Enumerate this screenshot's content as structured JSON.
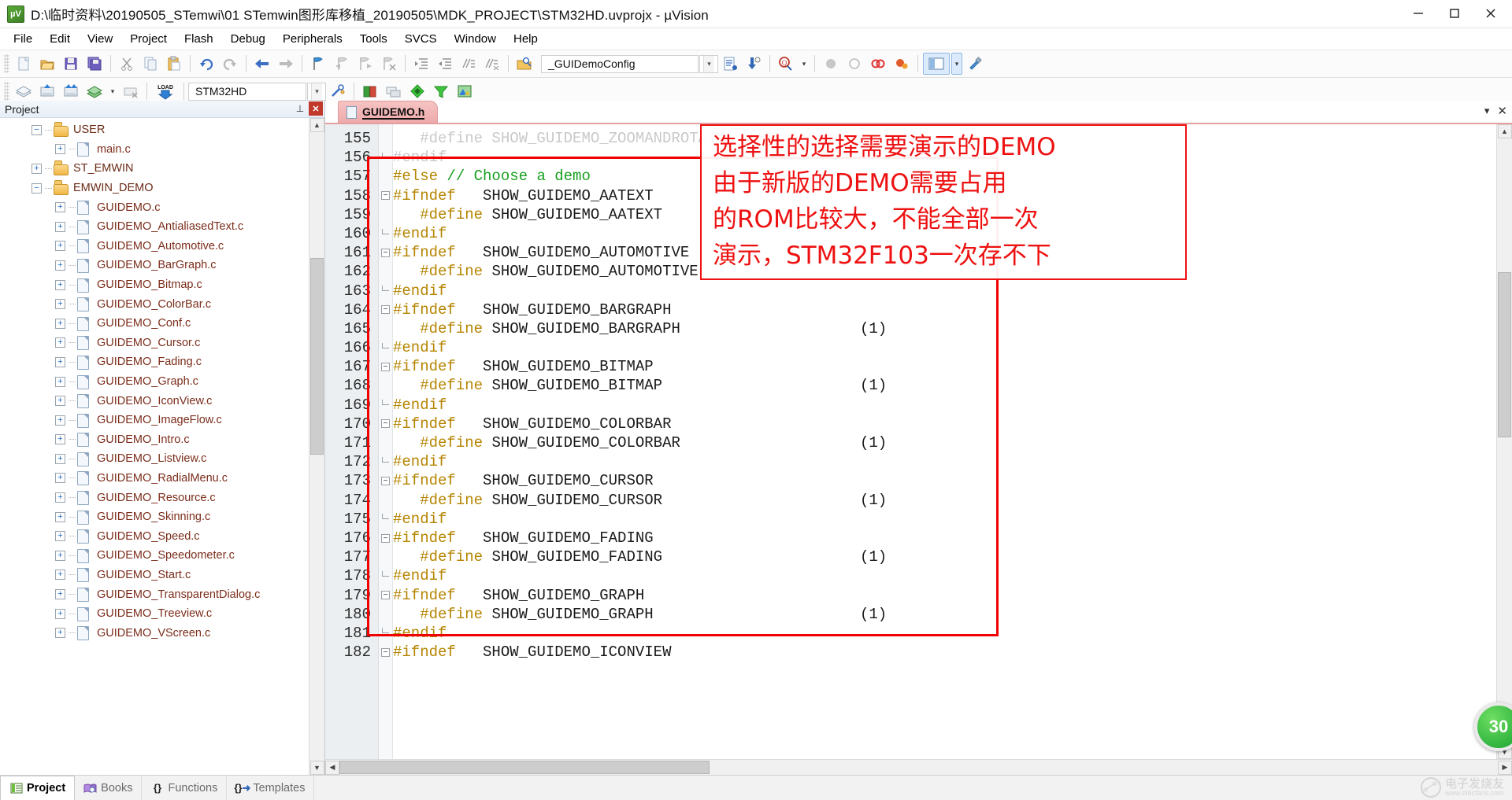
{
  "titlebar": {
    "title": "D:\\临时资料\\20190505_STemwi\\01 STemwin图形库移植_20190505\\MDK_PROJECT\\STM32HD.uvprojx - µVision",
    "app_icon": "uvision-icon",
    "minimize": "—",
    "maximize": "▢",
    "close": "✕"
  },
  "menubar": {
    "items": [
      "File",
      "Edit",
      "View",
      "Project",
      "Flash",
      "Debug",
      "Peripherals",
      "Tools",
      "SVCS",
      "Window",
      "Help"
    ]
  },
  "toolbar1": {
    "target_combo_value": "_GUIDemoConfig",
    "buttons": [
      "new-file-icon",
      "open-file-icon",
      "save-icon",
      "save-all-icon",
      "cut-icon",
      "copy-icon",
      "paste-icon",
      "undo-icon",
      "redo-icon",
      "navigate-back-icon",
      "navigate-forward-icon",
      "bookmark-toggle-icon",
      "bookmark-prev-icon",
      "bookmark-next-icon",
      "bookmark-clear-icon",
      "indent-icon",
      "outdent-icon",
      "comment-icon",
      "uncomment-icon",
      "browse-icon",
      "config-wizard-icon",
      "insert-include-icon",
      "find-in-files-icon",
      "debug-start-icon",
      "debug-stop-icon",
      "breakpoint-icon",
      "breakpoint-disable-icon",
      "window-layout-icon",
      "configure-icon"
    ]
  },
  "toolbar2": {
    "target_combo_value": "STM32HD",
    "buttons": [
      "translate-icon",
      "build-icon",
      "rebuild-icon",
      "batch-build-icon",
      "stop-build-icon",
      "download-icon",
      "target-options-icon",
      "manage-targets-icon",
      "multi-project-icon",
      "new-component-icon",
      "pack-installer-icon",
      "manage-run-env-icon"
    ]
  },
  "project_panel": {
    "header": "Project",
    "pin_icon": "pin-icon",
    "close_icon": "close-icon",
    "tree": [
      {
        "label": "USER",
        "indent": 1,
        "expander": "−",
        "icon": "folder-open-icon"
      },
      {
        "label": "main.c",
        "indent": 2,
        "expander": "+",
        "icon": "c-file-icon"
      },
      {
        "label": "ST_EMWIN",
        "indent": 1,
        "expander": "+",
        "icon": "folder-icon"
      },
      {
        "label": "EMWIN_DEMO",
        "indent": 1,
        "expander": "−",
        "icon": "folder-open-icon"
      },
      {
        "label": "GUIDEMO.c",
        "indent": 2,
        "expander": "+",
        "icon": "c-file-icon"
      },
      {
        "label": "GUIDEMO_AntialiasedText.c",
        "indent": 2,
        "expander": "+",
        "icon": "c-file-icon"
      },
      {
        "label": "GUIDEMO_Automotive.c",
        "indent": 2,
        "expander": "+",
        "icon": "c-file-icon"
      },
      {
        "label": "GUIDEMO_BarGraph.c",
        "indent": 2,
        "expander": "+",
        "icon": "c-file-icon"
      },
      {
        "label": "GUIDEMO_Bitmap.c",
        "indent": 2,
        "expander": "+",
        "icon": "c-file-icon"
      },
      {
        "label": "GUIDEMO_ColorBar.c",
        "indent": 2,
        "expander": "+",
        "icon": "c-file-icon"
      },
      {
        "label": "GUIDEMO_Conf.c",
        "indent": 2,
        "expander": "+",
        "icon": "c-file-icon"
      },
      {
        "label": "GUIDEMO_Cursor.c",
        "indent": 2,
        "expander": "+",
        "icon": "c-file-icon"
      },
      {
        "label": "GUIDEMO_Fading.c",
        "indent": 2,
        "expander": "+",
        "icon": "c-file-icon"
      },
      {
        "label": "GUIDEMO_Graph.c",
        "indent": 2,
        "expander": "+",
        "icon": "c-file-icon"
      },
      {
        "label": "GUIDEMO_IconView.c",
        "indent": 2,
        "expander": "+",
        "icon": "c-file-icon"
      },
      {
        "label": "GUIDEMO_ImageFlow.c",
        "indent": 2,
        "expander": "+",
        "icon": "c-file-icon"
      },
      {
        "label": "GUIDEMO_Intro.c",
        "indent": 2,
        "expander": "+",
        "icon": "c-file-icon"
      },
      {
        "label": "GUIDEMO_Listview.c",
        "indent": 2,
        "expander": "+",
        "icon": "c-file-icon"
      },
      {
        "label": "GUIDEMO_RadialMenu.c",
        "indent": 2,
        "expander": "+",
        "icon": "c-file-icon"
      },
      {
        "label": "GUIDEMO_Resource.c",
        "indent": 2,
        "expander": "+",
        "icon": "c-file-icon"
      },
      {
        "label": "GUIDEMO_Skinning.c",
        "indent": 2,
        "expander": "+",
        "icon": "c-file-icon"
      },
      {
        "label": "GUIDEMO_Speed.c",
        "indent": 2,
        "expander": "+",
        "icon": "c-file-icon"
      },
      {
        "label": "GUIDEMO_Speedometer.c",
        "indent": 2,
        "expander": "+",
        "icon": "c-file-icon"
      },
      {
        "label": "GUIDEMO_Start.c",
        "indent": 2,
        "expander": "+",
        "icon": "c-file-icon"
      },
      {
        "label": "GUIDEMO_TransparentDialog.c",
        "indent": 2,
        "expander": "+",
        "icon": "c-file-icon"
      },
      {
        "label": "GUIDEMO_Treeview.c",
        "indent": 2,
        "expander": "+",
        "icon": "c-file-icon"
      },
      {
        "label": "GUIDEMO_VScreen.c",
        "indent": 2,
        "expander": "+",
        "icon": "c-file-icon"
      }
    ]
  },
  "editor": {
    "tab_label": "GUIDEMO.h",
    "tab_icon": "h-file-icon",
    "lines": [
      {
        "n": "155",
        "fold": "",
        "text": "   #define SHOW_GUIDEMO_ZOOMANDROTATE",
        "style": "dim"
      },
      {
        "n": "156",
        "fold": "-",
        "text": "#endif",
        "style": "dim"
      },
      {
        "n": "157",
        "fold": "",
        "text": "#else // Choose a demo",
        "style": "else"
      },
      {
        "n": "158",
        "fold": "⊟",
        "text": "#ifndef   SHOW_GUIDEMO_AATEXT",
        "style": "ifndef"
      },
      {
        "n": "159",
        "fold": "",
        "text": "   #define SHOW_GUIDEMO_AATEXT",
        "style": "define",
        "value": ""
      },
      {
        "n": "160",
        "fold": "-",
        "text": "#endif",
        "style": "endif"
      },
      {
        "n": "161",
        "fold": "⊟",
        "text": "#ifndef   SHOW_GUIDEMO_AUTOMOTIVE",
        "style": "ifndef"
      },
      {
        "n": "162",
        "fold": "",
        "text": "   #define SHOW_GUIDEMO_AUTOMOTIVE",
        "style": "define",
        "value": ""
      },
      {
        "n": "163",
        "fold": "-",
        "text": "#endif",
        "style": "endif"
      },
      {
        "n": "164",
        "fold": "⊟",
        "text": "#ifndef   SHOW_GUIDEMO_BARGRAPH",
        "style": "ifndef"
      },
      {
        "n": "165",
        "fold": "",
        "text": "   #define SHOW_GUIDEMO_BARGRAPH",
        "style": "define",
        "value": "(1)"
      },
      {
        "n": "166",
        "fold": "-",
        "text": "#endif",
        "style": "endif"
      },
      {
        "n": "167",
        "fold": "⊟",
        "text": "#ifndef   SHOW_GUIDEMO_BITMAP",
        "style": "ifndef"
      },
      {
        "n": "168",
        "fold": "",
        "text": "   #define SHOW_GUIDEMO_BITMAP",
        "style": "define",
        "value": "(1)"
      },
      {
        "n": "169",
        "fold": "-",
        "text": "#endif",
        "style": "endif"
      },
      {
        "n": "170",
        "fold": "⊟",
        "text": "#ifndef   SHOW_GUIDEMO_COLORBAR",
        "style": "ifndef"
      },
      {
        "n": "171",
        "fold": "",
        "text": "   #define SHOW_GUIDEMO_COLORBAR",
        "style": "define",
        "value": "(1)"
      },
      {
        "n": "172",
        "fold": "-",
        "text": "#endif",
        "style": "endif"
      },
      {
        "n": "173",
        "fold": "⊟",
        "text": "#ifndef   SHOW_GUIDEMO_CURSOR",
        "style": "ifndef"
      },
      {
        "n": "174",
        "fold": "",
        "text": "   #define SHOW_GUIDEMO_CURSOR",
        "style": "define",
        "value": "(1)"
      },
      {
        "n": "175",
        "fold": "-",
        "text": "#endif",
        "style": "endif"
      },
      {
        "n": "176",
        "fold": "⊟",
        "text": "#ifndef   SHOW_GUIDEMO_FADING",
        "style": "ifndef"
      },
      {
        "n": "177",
        "fold": "",
        "text": "   #define SHOW_GUIDEMO_FADING",
        "style": "define",
        "value": "(1)"
      },
      {
        "n": "178",
        "fold": "-",
        "text": "#endif",
        "style": "endif"
      },
      {
        "n": "179",
        "fold": "⊟",
        "text": "#ifndef   SHOW_GUIDEMO_GRAPH",
        "style": "ifndef"
      },
      {
        "n": "180",
        "fold": "",
        "text": "   #define SHOW_GUIDEMO_GRAPH",
        "style": "define",
        "value": "(1)"
      },
      {
        "n": "181",
        "fold": "-",
        "text": "#endif",
        "style": "endif"
      },
      {
        "n": "182",
        "fold": "⊟",
        "text": "#ifndef   SHOW_GUIDEMO_ICONVIEW",
        "style": "ifndef"
      }
    ]
  },
  "annotation": {
    "lines": [
      "选择性的选择需要演示的DEMO",
      "由于新版的DEMO需要占用",
      "的ROM比较大，不能全部一次",
      "演示，STM32F103一次存不下"
    ],
    "color": "#ee1111"
  },
  "bottom_tabs": [
    {
      "label": "Project",
      "icon": "project-icon",
      "active": true
    },
    {
      "label": "Books",
      "icon": "books-icon",
      "active": false
    },
    {
      "label": "Functions",
      "icon": "functions-icon",
      "active": false
    },
    {
      "label": "Templates",
      "icon": "templates-icon",
      "active": false
    }
  ],
  "widgets": {
    "green_badge": "30",
    "watermark_cn": "电子发烧友",
    "watermark_url": "www.elecfans.com"
  }
}
